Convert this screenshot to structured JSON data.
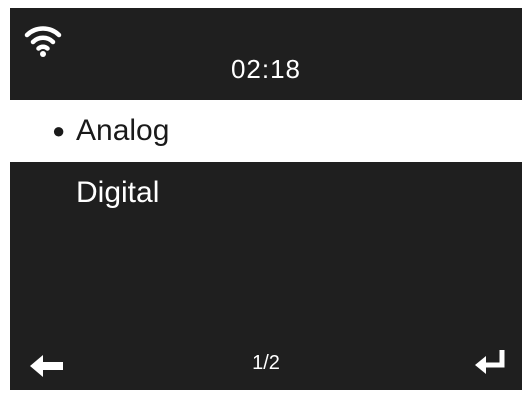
{
  "status_bar": {
    "wifi_icon": "wifi-icon",
    "time": "02:18"
  },
  "menu": {
    "items": [
      {
        "label": "Analog",
        "selected": true
      },
      {
        "label": "Digital",
        "selected": false
      }
    ],
    "bullet": "●"
  },
  "footer": {
    "back_icon": "arrow-left-icon",
    "page": "1/2",
    "enter_icon": "enter-return-icon"
  },
  "colors": {
    "screen_background": "#1f1f1f",
    "selected_background": "#ffffff",
    "text": "#ffffff",
    "selected_text": "#1a1a1a"
  }
}
